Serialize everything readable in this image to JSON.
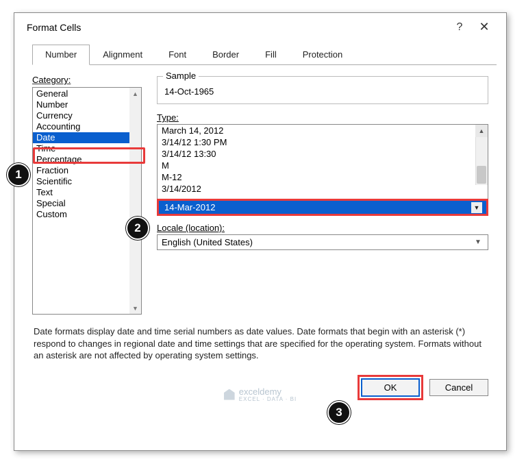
{
  "dialog": {
    "title": "Format Cells",
    "help_glyph": "?",
    "close_glyph": "✕"
  },
  "tabs": [
    {
      "label": "Number"
    },
    {
      "label": "Alignment"
    },
    {
      "label": "Font"
    },
    {
      "label": "Border"
    },
    {
      "label": "Fill"
    },
    {
      "label": "Protection"
    }
  ],
  "category": {
    "label": "Category:",
    "items": [
      "General",
      "Number",
      "Currency",
      "Accounting",
      "Date",
      "Time",
      "Percentage",
      "Fraction",
      "Scientific",
      "Text",
      "Special",
      "Custom"
    ]
  },
  "sample": {
    "legend": "Sample",
    "value": "14-Oct-1965"
  },
  "type": {
    "label": "Type:",
    "items": [
      "March 14, 2012",
      "3/14/12 1:30 PM",
      "3/14/12 13:30",
      "M",
      "M-12",
      "3/14/2012"
    ],
    "selected": "14-Mar-2012"
  },
  "locale": {
    "label": "Locale (location):",
    "value": "English (United States)"
  },
  "help_text": "Date formats display date and time serial numbers as date values.  Date formats that begin with an asterisk (*) respond to changes in regional date and time settings that are specified for the operating system. Formats without an asterisk are not affected by operating system settings.",
  "buttons": {
    "ok": "OK",
    "cancel": "Cancel"
  },
  "callouts": {
    "c1": "1",
    "c2": "2",
    "c3": "3"
  },
  "watermark": {
    "name": "exceldemy",
    "sub": "EXCEL · DATA · BI"
  }
}
